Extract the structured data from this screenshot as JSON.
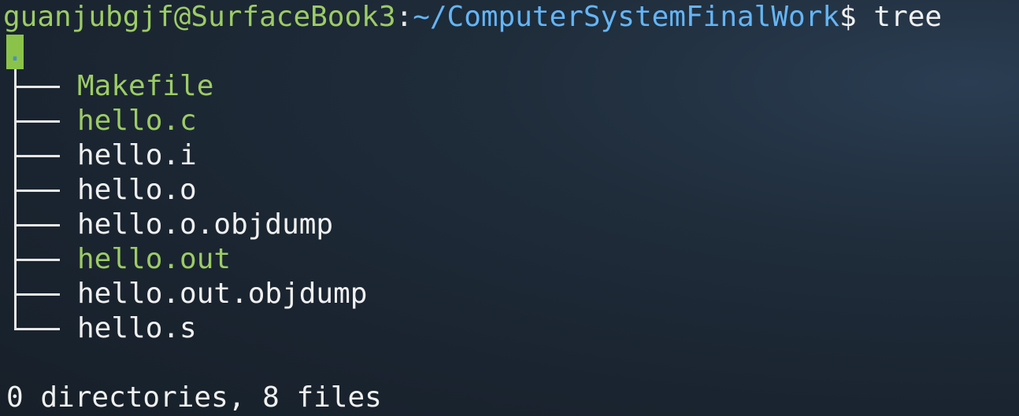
{
  "prompt": {
    "user_host": "guanjubgjf@SurfaceBook3",
    "colon": ":",
    "path": "~/ComputerSystemFinalWork",
    "dollar": "$",
    "command": " tree"
  },
  "tree": {
    "root": ".",
    "items": [
      {
        "name": "Makefile",
        "type": "exec"
      },
      {
        "name": "hello.c",
        "type": "exec"
      },
      {
        "name": "hello.i",
        "type": "plain"
      },
      {
        "name": "hello.o",
        "type": "plain"
      },
      {
        "name": "hello.o.objdump",
        "type": "plain"
      },
      {
        "name": "hello.out",
        "type": "exec"
      },
      {
        "name": "hello.out.objdump",
        "type": "plain"
      },
      {
        "name": "hello.s",
        "type": "plain"
      }
    ]
  },
  "summary": "0 directories, 8 files",
  "colors": {
    "user": "#9ccc65",
    "path": "#64b5f6",
    "exec": "#9ccc65",
    "plain": "#f0f0f0",
    "background": "#1f2c3a"
  }
}
